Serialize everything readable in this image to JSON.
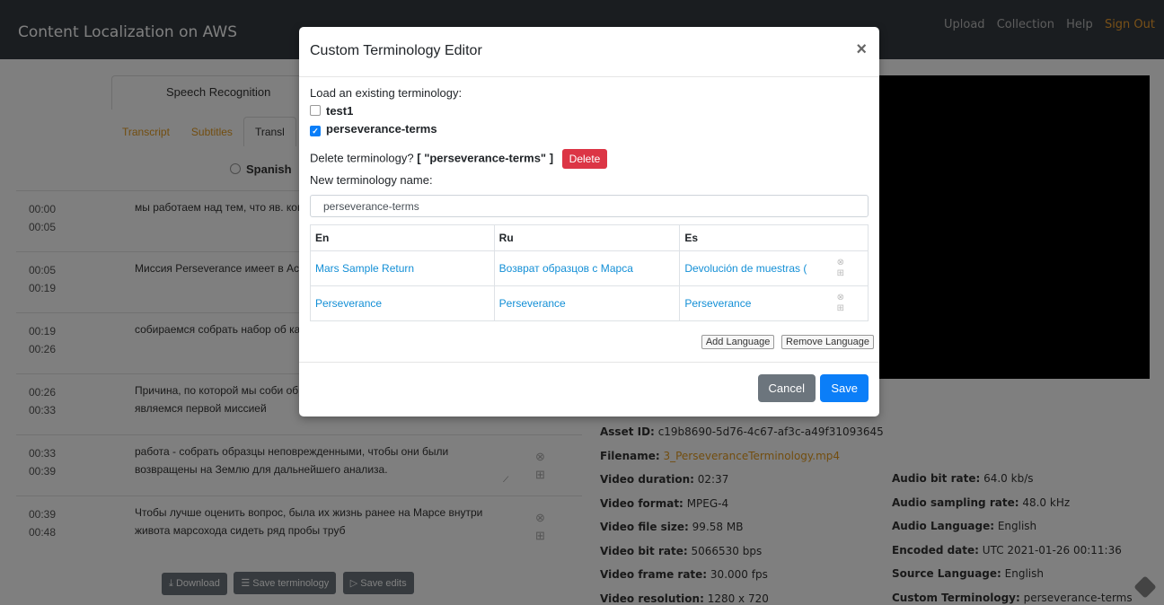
{
  "nav": {
    "brand": "Content Localization on AWS",
    "links": [
      "Upload",
      "Collection",
      "Help"
    ],
    "signout": "Sign Out"
  },
  "background": {
    "main_tab": "Speech Recognition",
    "sub_tabs": [
      "Transcript",
      "Subtitles",
      "Transl"
    ],
    "language": "Spanish",
    "segments": [
      {
        "start": "00:00",
        "end": "00:05",
        "text": "мы работаем над тем, что яв. когда-либо пытались отправ"
      },
      {
        "start": "00:05",
        "end": "00:19",
        "text": "Миссия Perseverance имеет в Астробиология, а также явля"
      },
      {
        "start": "00:19",
        "end": "00:26",
        "text": "собираемся собрать набор об каждый из которых весит око"
      },
      {
        "start": "00:26",
        "end": "00:33",
        "text": "Причина, по которой мы соби образцы, заключается в том, что мы являемся первой миссией"
      },
      {
        "start": "00:33",
        "end": "00:39",
        "text": "работа - собрать образцы неповрежденными, чтобы они были возвращены на Землю для дальнейшего анализа."
      },
      {
        "start": "00:39",
        "end": "00:48",
        "text": "Чтобы лучше оценить вопрос, была их жизнь ранее на Марсе внутри живота марсохода сидеть ряд пробы труб"
      }
    ],
    "actions": {
      "download": "Download",
      "save_terminology": "Save terminology",
      "save_edits": "Save edits"
    },
    "meta_left": [
      {
        "k": "Asset ID:",
        "v": "c19b8690-5d76-4c67-af3c-a49f31093645"
      },
      {
        "k": "Filename:",
        "v": "3_PerseveranceTerminology.mp4"
      },
      {
        "k": "Video duration:",
        "v": "02:37"
      },
      {
        "k": "Video format:",
        "v": "MPEG-4"
      },
      {
        "k": "Video file size:",
        "v": "99.58 MB"
      },
      {
        "k": "Video bit rate:",
        "v": "5066530 bps"
      },
      {
        "k": "Video frame rate:",
        "v": "30.000 fps"
      },
      {
        "k": "Video resolution:",
        "v": "1280 x 720"
      }
    ],
    "meta_right": [
      {
        "k": "Audio bit rate:",
        "v": "64.0 kb/s"
      },
      {
        "k": "Audio sampling rate:",
        "v": "48.0 kHz"
      },
      {
        "k": "Audio Language:",
        "v": "English"
      },
      {
        "k": "Encoded date:",
        "v": "UTC 2021-01-26 00:11:36"
      },
      {
        "k": "Source Language:",
        "v": "English"
      },
      {
        "k": "Custom Terminology:",
        "v": "perseverance-terms"
      }
    ]
  },
  "modal": {
    "title": "Custom Terminology Editor",
    "close": "×",
    "load_label": "Load an existing terminology:",
    "terminologies": [
      {
        "name": "test1",
        "checked": false
      },
      {
        "name": "perseverance-terms",
        "checked": true
      }
    ],
    "delete_prompt": "Delete terminology?",
    "delete_target": "[ \"perseverance-terms\" ]",
    "delete_button": "Delete",
    "new_name_label": "New terminology name:",
    "new_name_value": "perseverance-terms",
    "table": {
      "headers": [
        "En",
        "Ru",
        "Es"
      ],
      "rows": [
        [
          "Mars Sample Return",
          "Возврат образцов с Марса",
          "Devolución de muestras ("
        ],
        [
          "Perseverance",
          "Perseverance",
          "Perseverance"
        ]
      ]
    },
    "add_language": "Add Language",
    "remove_language": "Remove Language",
    "cancel": "Cancel",
    "save": "Save"
  }
}
